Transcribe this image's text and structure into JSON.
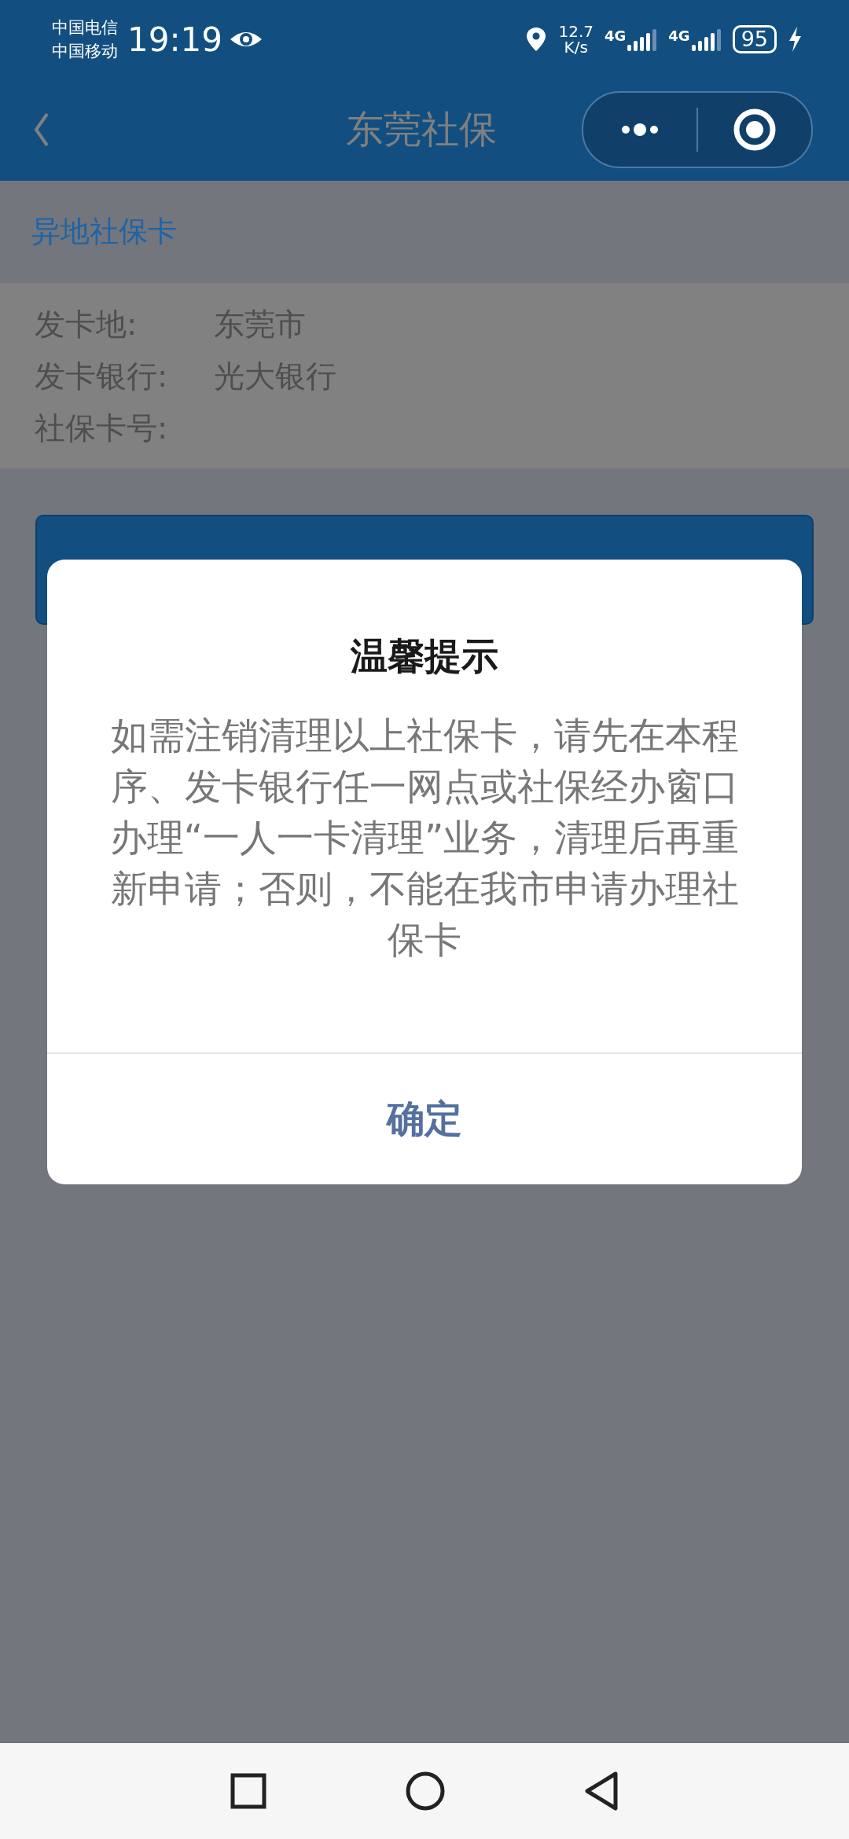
{
  "status_bar": {
    "carriers": [
      "中国电信",
      "中国移动"
    ],
    "time": "19:19",
    "speed": [
      "12.7",
      "K/s"
    ],
    "sims": [
      {
        "network": "4G"
      },
      {
        "network": "4G"
      }
    ],
    "battery": "95",
    "charging": true
  },
  "header": {
    "title": "东莞社保"
  },
  "section_title": "异地社保卡",
  "info": [
    {
      "label": "发卡地:",
      "value": "东莞市"
    },
    {
      "label": "发卡银行:",
      "value": "光大银行"
    },
    {
      "label": "社保卡号:"
    }
  ],
  "dialog": {
    "title": "温馨提示",
    "message": "如需注销清理以上社保卡，请先在本程序、发卡银行任一网点或社保经办窗口办理“一人一卡清理”业务，清理后再重新申请；否则，不能在我市申请办理社保卡",
    "button": "确定"
  }
}
